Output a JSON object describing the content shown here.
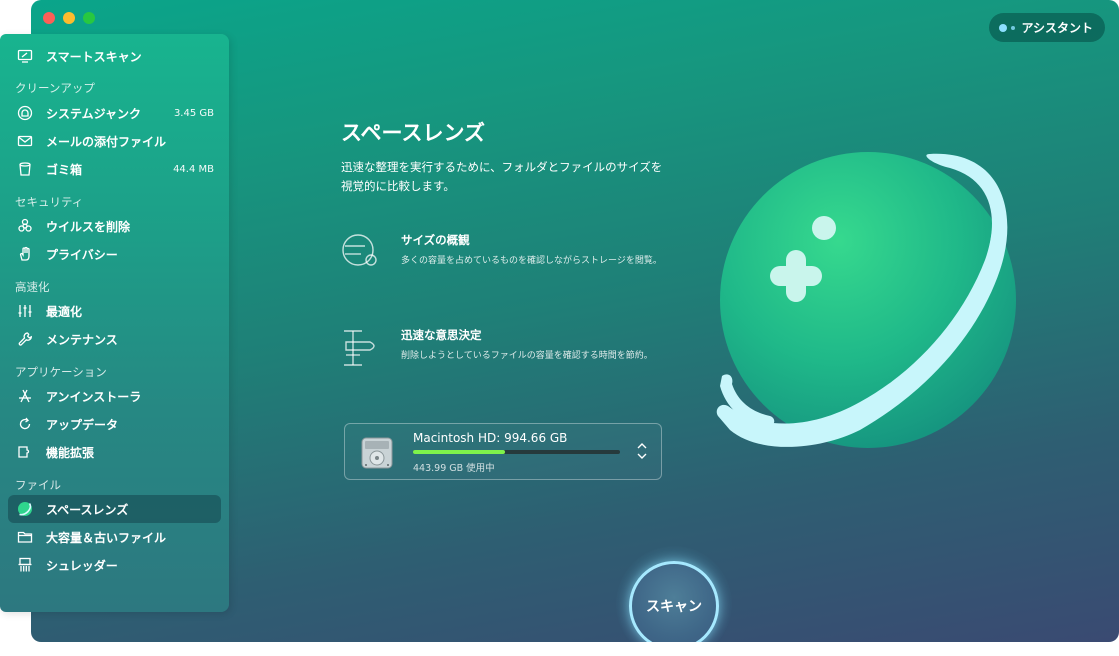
{
  "window": {
    "assistant_label": "アシスタント"
  },
  "sidebar": {
    "smart_scan": "スマートスキャン",
    "sections": {
      "cleanup": "クリーンアップ",
      "security": "セキュリティ",
      "speedup": "高速化",
      "applications": "アプリケーション",
      "files": "ファイル"
    },
    "items": {
      "system_junk": {
        "label": "システムジャンク",
        "size": "3.45 GB"
      },
      "mail_attachments": {
        "label": "メールの添付ファイル"
      },
      "trash": {
        "label": "ゴミ箱",
        "size": "44.4 MB"
      },
      "malware_removal": {
        "label": "ウイルスを削除"
      },
      "privacy": {
        "label": "プライバシー"
      },
      "optimization": {
        "label": "最適化"
      },
      "maintenance": {
        "label": "メンテナンス"
      },
      "uninstaller": {
        "label": "アンインストーラ"
      },
      "updater": {
        "label": "アップデータ"
      },
      "extensions": {
        "label": "機能拡張"
      },
      "space_lens": {
        "label": "スペースレンズ",
        "selected": true
      },
      "large_old_files": {
        "label": "大容量＆古いファイル"
      },
      "shredder": {
        "label": "シュレッダー"
      }
    }
  },
  "main": {
    "title": "スペースレンズ",
    "description": "迅速な整理を実行するために、フォルダとファイルのサイズを視覚的に比較します。",
    "features": [
      {
        "icon": "size-overview-icon",
        "title": "サイズの概観",
        "desc": "多くの容量を占めているものを確認しながらストレージを閲覧。"
      },
      {
        "icon": "quick-decision-icon",
        "title": "迅速な意思決定",
        "desc": "削除しようとしているファイルの容量を確認する時間を節約。"
      }
    ],
    "disk": {
      "name": "Macintosh HD: 994.66 GB",
      "used": "443.99 GB 使用中",
      "used_fraction": 0.4464
    },
    "scan_button": "スキャン"
  },
  "colors": {
    "accent_green": "#7ef24b",
    "scan_ring": "#a6e9ff",
    "planet_green": "#2ecf8a"
  }
}
